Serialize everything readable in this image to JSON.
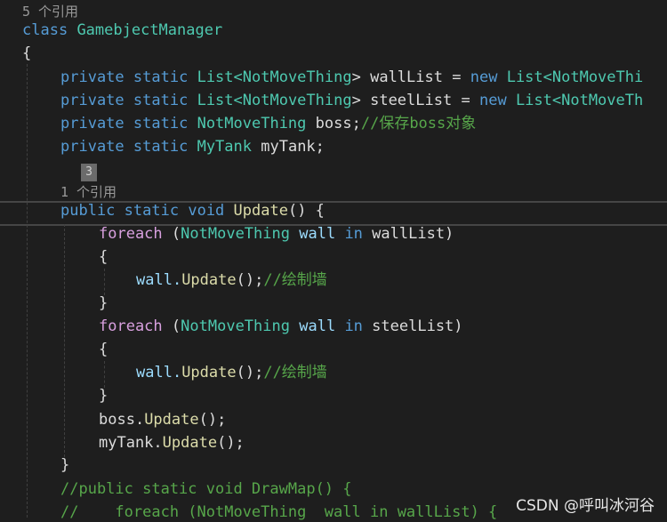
{
  "code": {
    "ref_count_class": "5 个引用",
    "class_kw": "class",
    "class_name": "GamebjectManager",
    "open_brace": "{",
    "close_brace": "}",
    "kw_private": "private",
    "kw_static": "static",
    "kw_new": "new",
    "type_list_open": "List<",
    "type_notmovething": "NotMoveThing",
    "gt": ">",
    "var_walllist": "wallList",
    "var_steellist": "steelList",
    "eq": "=",
    "list_init_trunc": "List<NotMoveThi",
    "list_init_trunc2": "List<NotMoveTh",
    "boss_decl": "boss;",
    "boss_comment": "//保存boss对象",
    "type_mytank": "MyTank",
    "mytank_decl": "myTank;",
    "badge_number": "3",
    "ref_count_update": "1 个引用",
    "kw_public": "public",
    "kw_void": "void",
    "fn_update": "Update",
    "paren_brace": "() {",
    "kw_foreach": "foreach",
    "lparen": "(",
    "var_wall": "wall",
    "kw_in": "in",
    "walllist_close": "wallList)",
    "steellist_close": "steelList)",
    "wall_prefix": "wall.",
    "call_end": "();",
    "draw_wall_comment": "//绘制墙",
    "boss_prefix": "boss.",
    "mytank_prefix": "myTank.",
    "comment_drawmap": "//public static void DrawMap() {",
    "comment_foreach": "//    foreach (NotMoveThing  wall in wallList) {"
  },
  "watermark": "CSDN @呼叫冰河谷"
}
